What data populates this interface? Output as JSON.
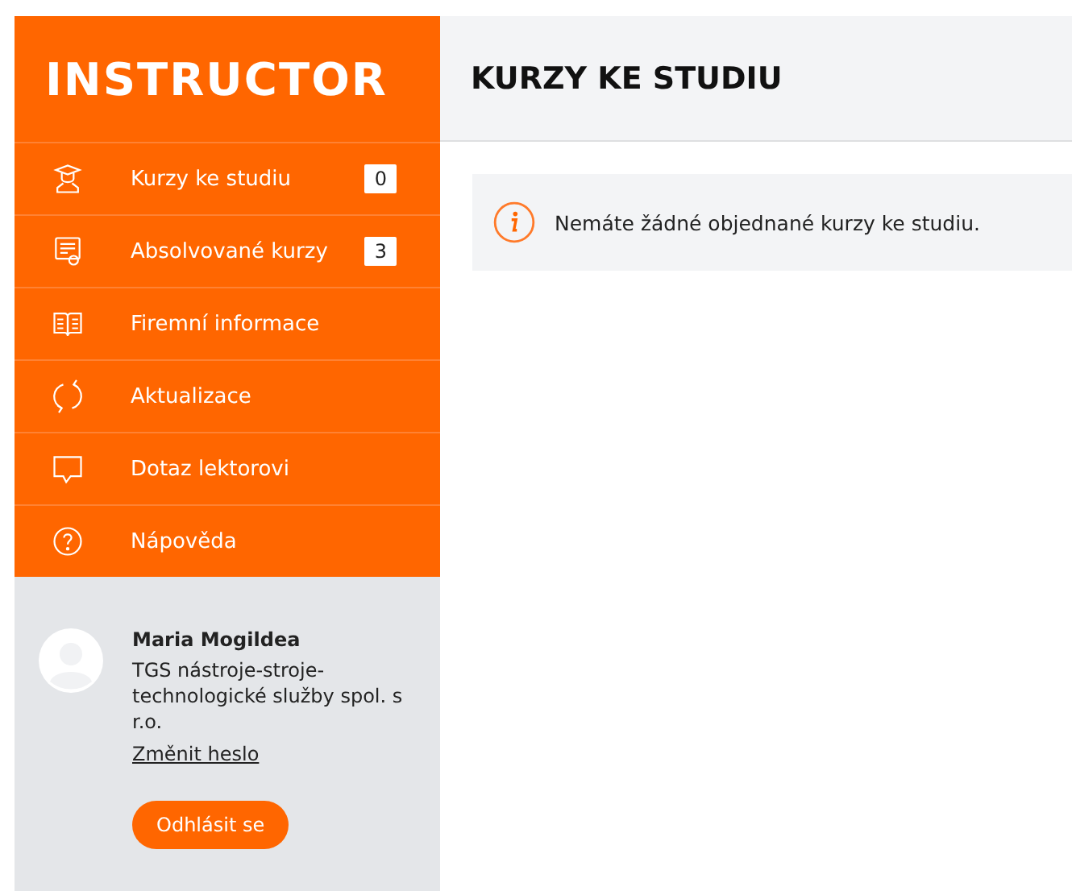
{
  "sidebar": {
    "logo": "INSTRUCTOR",
    "items": [
      {
        "kind": "graduate",
        "label": "Kurzy ke studiu",
        "badge": "0"
      },
      {
        "kind": "certificate",
        "label": "Absolvované kurzy",
        "badge": "3"
      },
      {
        "kind": "book",
        "label": "Firemní informace"
      },
      {
        "kind": "refresh",
        "label": "Aktualizace"
      },
      {
        "kind": "chat",
        "label": "Dotaz lektorovi"
      },
      {
        "kind": "help",
        "label": "Nápověda"
      }
    ],
    "user": {
      "name": "Maria Mogildea",
      "company": "TGS nástroje-stroje-technologické služby spol. s r.o.",
      "change_password": "Změnit heslo",
      "logout": "Odhlásit se"
    }
  },
  "main": {
    "title": "KURZY KE STUDIU",
    "notice": "Nemáte žádné objednané kurzy ke studiu."
  }
}
